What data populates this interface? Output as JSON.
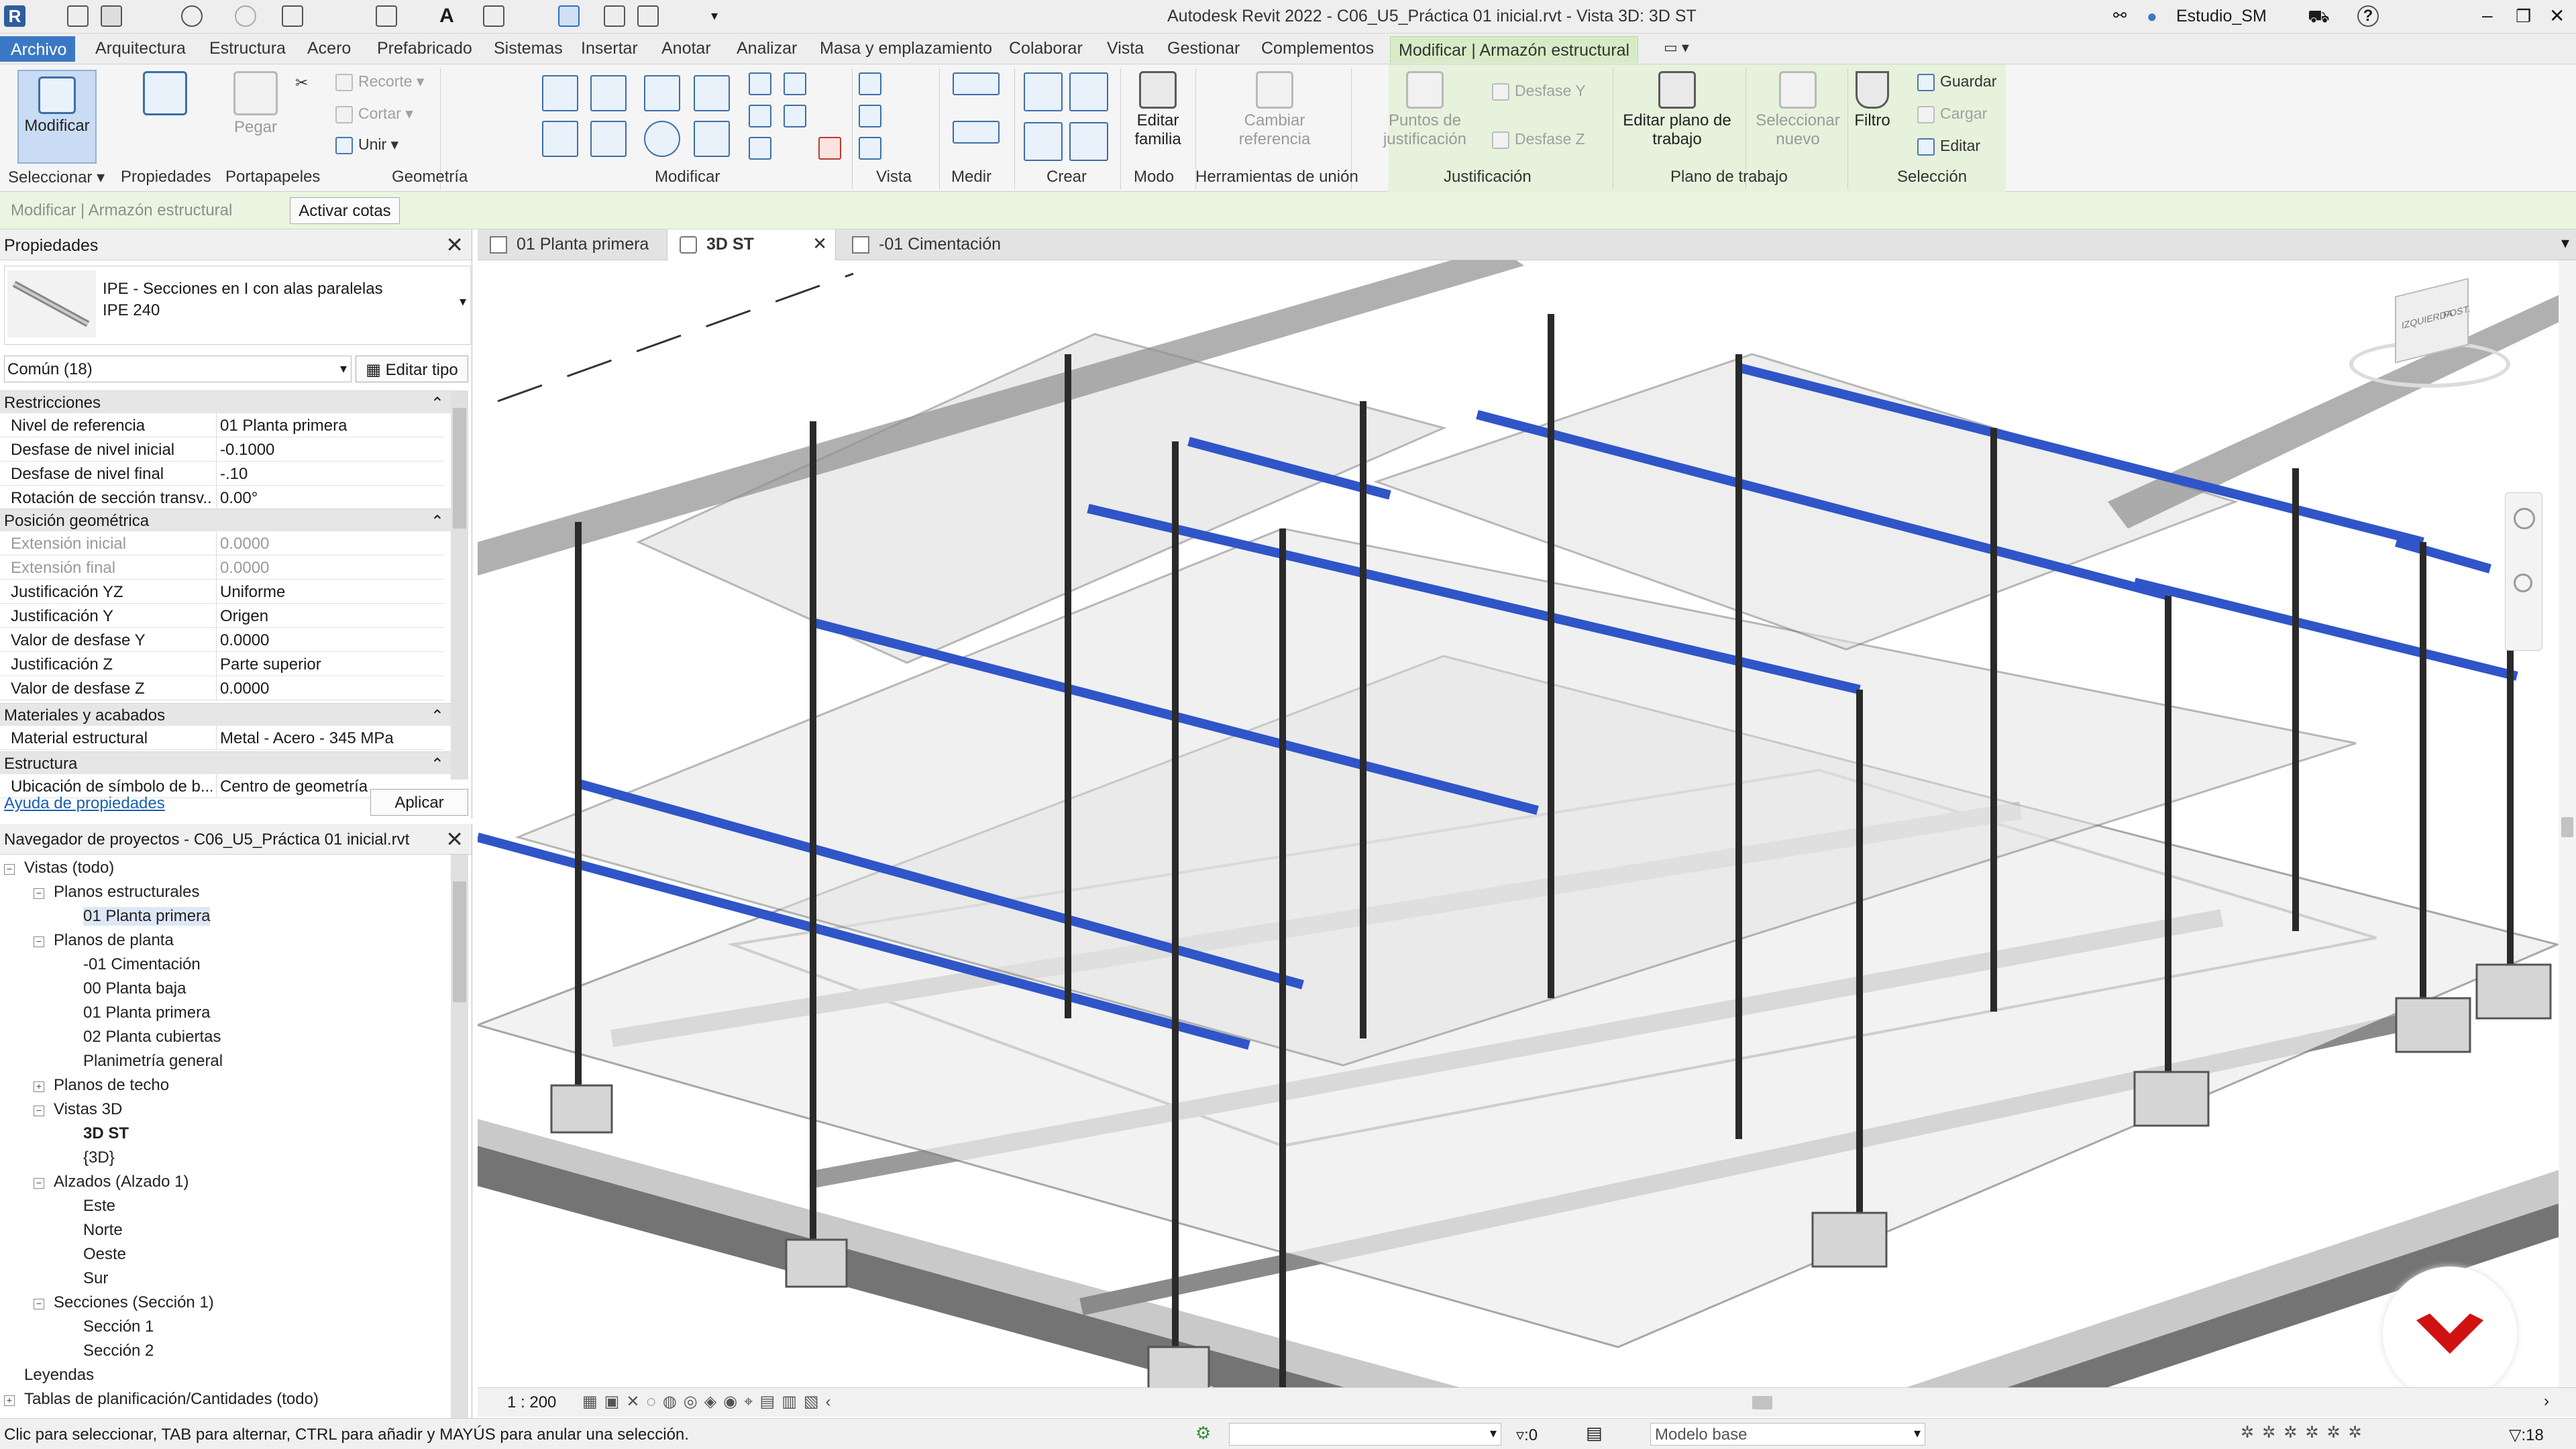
{
  "window": {
    "title": "Autodesk Revit 2022 - C06_U5_Práctica 01 inicial.rvt - Vista 3D: 3D ST",
    "user": "Estudio_SM"
  },
  "menu": {
    "archivo": "Archivo",
    "items": [
      "Arquitectura",
      "Estructura",
      "Acero",
      "Prefabricado",
      "Sistemas",
      "Insertar",
      "Anotar",
      "Analizar",
      "Masa y emplazamiento",
      "Colaborar",
      "Vista",
      "Gestionar",
      "Complementos"
    ],
    "contextual": "Modificar | Armazón estructural"
  },
  "ribbon": {
    "modificar": "Modificar",
    "propiedades": "Propiedades",
    "pegar": "Pegar",
    "recorte": "Recorte",
    "cortar": "Cortar",
    "unir": "Unir",
    "editar_familia": "Editar familia",
    "cambiar_referencia": "Cambiar referencia",
    "puntos_justificacion": "Puntos de justificación",
    "desfase_y": "Desfase Y",
    "desfase_z": "Desfase Z",
    "editar_plano": "Editar plano de trabajo",
    "seleccionar_nuevo": "Seleccionar nuevo",
    "filtro": "Filtro",
    "guardar": "Guardar",
    "cargar": "Cargar",
    "editar": "Editar",
    "groups": {
      "seleccionar": "Seleccionar",
      "propiedades": "Propiedades",
      "portapapeles": "Portapapeles",
      "geometria": "Geometría",
      "modificar": "Modificar",
      "vista": "Vista",
      "medir": "Medir",
      "crear": "Crear",
      "modo": "Modo",
      "union": "Herramientas de unión",
      "justificacion": "Justificación",
      "plano": "Plano de trabajo",
      "seleccion": "Selección"
    }
  },
  "options": {
    "context": "Modificar | Armazón estructural",
    "activar_cotas": "Activar cotas"
  },
  "tabs": [
    "01 Planta primera",
    "3D ST",
    "-01 Cimentación"
  ],
  "properties": {
    "title": "Propiedades",
    "type_line1": "IPE - Secciones en I con alas paralelas",
    "type_line2": "IPE 240",
    "filter": "Común (18)",
    "edit_type": "Editar tipo",
    "cat_restricciones": "Restricciones",
    "cat_posicion": "Posición geométrica",
    "cat_materiales": "Materiales y acabados",
    "cat_estructura": "Estructura",
    "rows_restricciones": [
      {
        "k": "Nivel de referencia",
        "v": "01 Planta primera"
      },
      {
        "k": "Desfase de nivel inicial",
        "v": "-0.1000"
      },
      {
        "k": "Desfase de nivel final",
        "v": "-.10"
      },
      {
        "k": "Rotación de sección transv...",
        "v": "0.00°"
      }
    ],
    "rows_posicion": [
      {
        "k": "Extensión inicial",
        "v": "0.0000"
      },
      {
        "k": "Extensión final",
        "v": "0.0000"
      },
      {
        "k": "Justificación YZ",
        "v": "Uniforme"
      },
      {
        "k": "Justificación Y",
        "v": "Origen"
      },
      {
        "k": "Valor de desfase Y",
        "v": "0.0000"
      },
      {
        "k": "Justificación Z",
        "v": "Parte superior"
      },
      {
        "k": "Valor de desfase Z",
        "v": "0.0000"
      }
    ],
    "rows_materiales": [
      {
        "k": "Material estructural",
        "v": "Metal - Acero - 345 MPa"
      }
    ],
    "rows_estructura": [
      {
        "k": "Ubicación de símbolo de b...",
        "v": "Centro de geometría"
      }
    ],
    "help": "Ayuda de propiedades",
    "apply": "Aplicar"
  },
  "browser": {
    "title": "Navegador de proyectos - C06_U5_Práctica 01 inicial.rvt",
    "nodes": [
      "Vistas (todo)",
      "Planos estructurales",
      "01 Planta primera",
      "Planos de planta",
      "-01 Cimentación",
      "00 Planta baja",
      "01 Planta primera",
      "02 Planta cubiertas",
      "Planimetría general",
      "Planos de techo",
      "Vistas 3D",
      "3D ST",
      "{3D}",
      "Alzados (Alzado 1)",
      "Este",
      "Norte",
      "Oeste",
      "Sur",
      "Secciones (Sección 1)",
      "Sección 1",
      "Sección 2",
      "Leyendas",
      "Tablas de planificación/Cantidades (todo)"
    ]
  },
  "viewcube": {
    "face1": "IZQUIERDA",
    "face2": "POST."
  },
  "viewbar": {
    "scale": "1 : 200"
  },
  "status": {
    "message": "Clic para seleccionar, TAB para alternar, CTRL para añadir y MAYÚS para anular una selección.",
    "selcount": ":0",
    "model": "Modelo base",
    "filter_count": ":18"
  },
  "colors": {
    "accent": "#3b78c4",
    "context_tab": "#d7ecc6",
    "beam_selected": "#2f55c8"
  }
}
